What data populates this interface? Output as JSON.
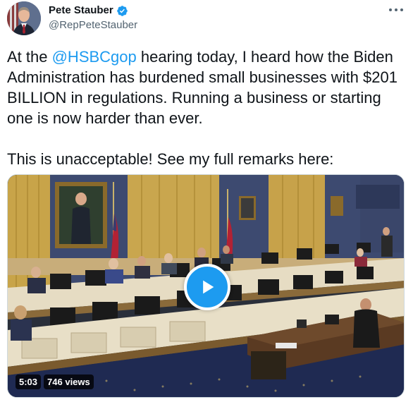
{
  "author": {
    "display_name": "Pete Stauber",
    "handle": "@RepPeteStauber",
    "verified": true
  },
  "tweet": {
    "text_part1": "At the ",
    "mention": "@HSBCgop",
    "text_part2": " hearing today, I heard how the Biden Administration has burdened small businesses with $201 BILLION in regulations. Running a business or starting one is now harder than ever.",
    "text_para2": "This is unacceptable! See my full remarks here:"
  },
  "video": {
    "duration": "5:03",
    "views": "746 views"
  },
  "icons": {
    "verified": "verified-badge-icon",
    "more": "more-options-icon",
    "play": "play-icon"
  },
  "colors": {
    "accent": "#1d9bf0",
    "text": "#0f1419",
    "secondary": "#536471"
  }
}
